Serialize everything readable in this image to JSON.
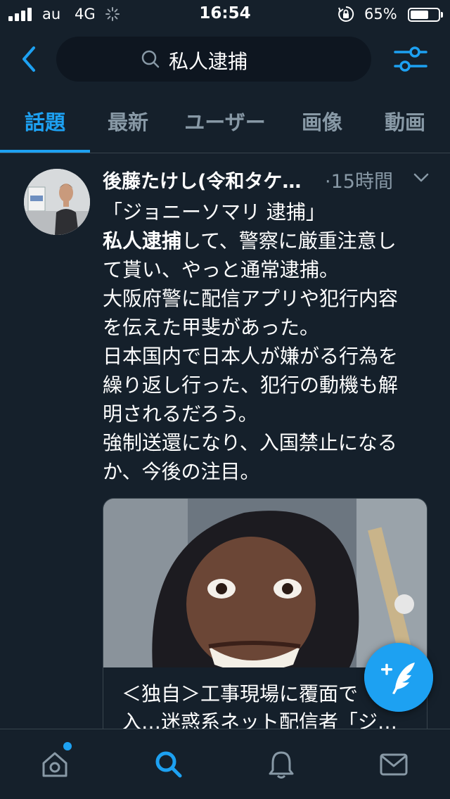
{
  "status_bar": {
    "carrier": "au",
    "network": "4G",
    "time": "16:54",
    "battery_percent_text": "65%",
    "battery_level": 0.65
  },
  "search": {
    "query": "私人逮捕"
  },
  "tabs": [
    {
      "label": "話題",
      "active": true
    },
    {
      "label": "最新",
      "active": false
    },
    {
      "label": "ユーザー",
      "active": false
    },
    {
      "label": "画像",
      "active": false
    },
    {
      "label": "動画",
      "active": false
    }
  ],
  "tweet": {
    "author_name": "後藤たけし(令和タケ…",
    "time": "·15時間",
    "body_lines": [
      "「ジョニーソマリ 逮捕」",
      "して、警察に厳重注意し",
      "て貰い、やっと通常逮捕。",
      "大阪府警に配信アプリや犯行内容",
      "を伝えた甲斐があった。",
      "日本国内で日本人が嫌がる行為を",
      "繰り返し行った、犯行の動機も解",
      "明されるだろう。",
      "強制送還になり、入国禁止になる",
      "か、今後の注目。"
    ],
    "highlight": "私人逮捕",
    "card_title_lines": [
      "＜独自＞工事現場に覆面で",
      "入…迷惑系ネット配信者「ジ…"
    ]
  },
  "colors": {
    "background": "#15202b",
    "accent": "#1da1f2",
    "secondary_text": "#8899a6",
    "divider": "#38444d"
  },
  "icons": {
    "back": "chevron-left-icon",
    "search": "search-icon",
    "filter": "sliders-icon",
    "home": "home-icon",
    "explore": "search-icon",
    "notifications": "bell-icon",
    "messages": "mail-icon",
    "compose": "compose-feather-icon"
  }
}
